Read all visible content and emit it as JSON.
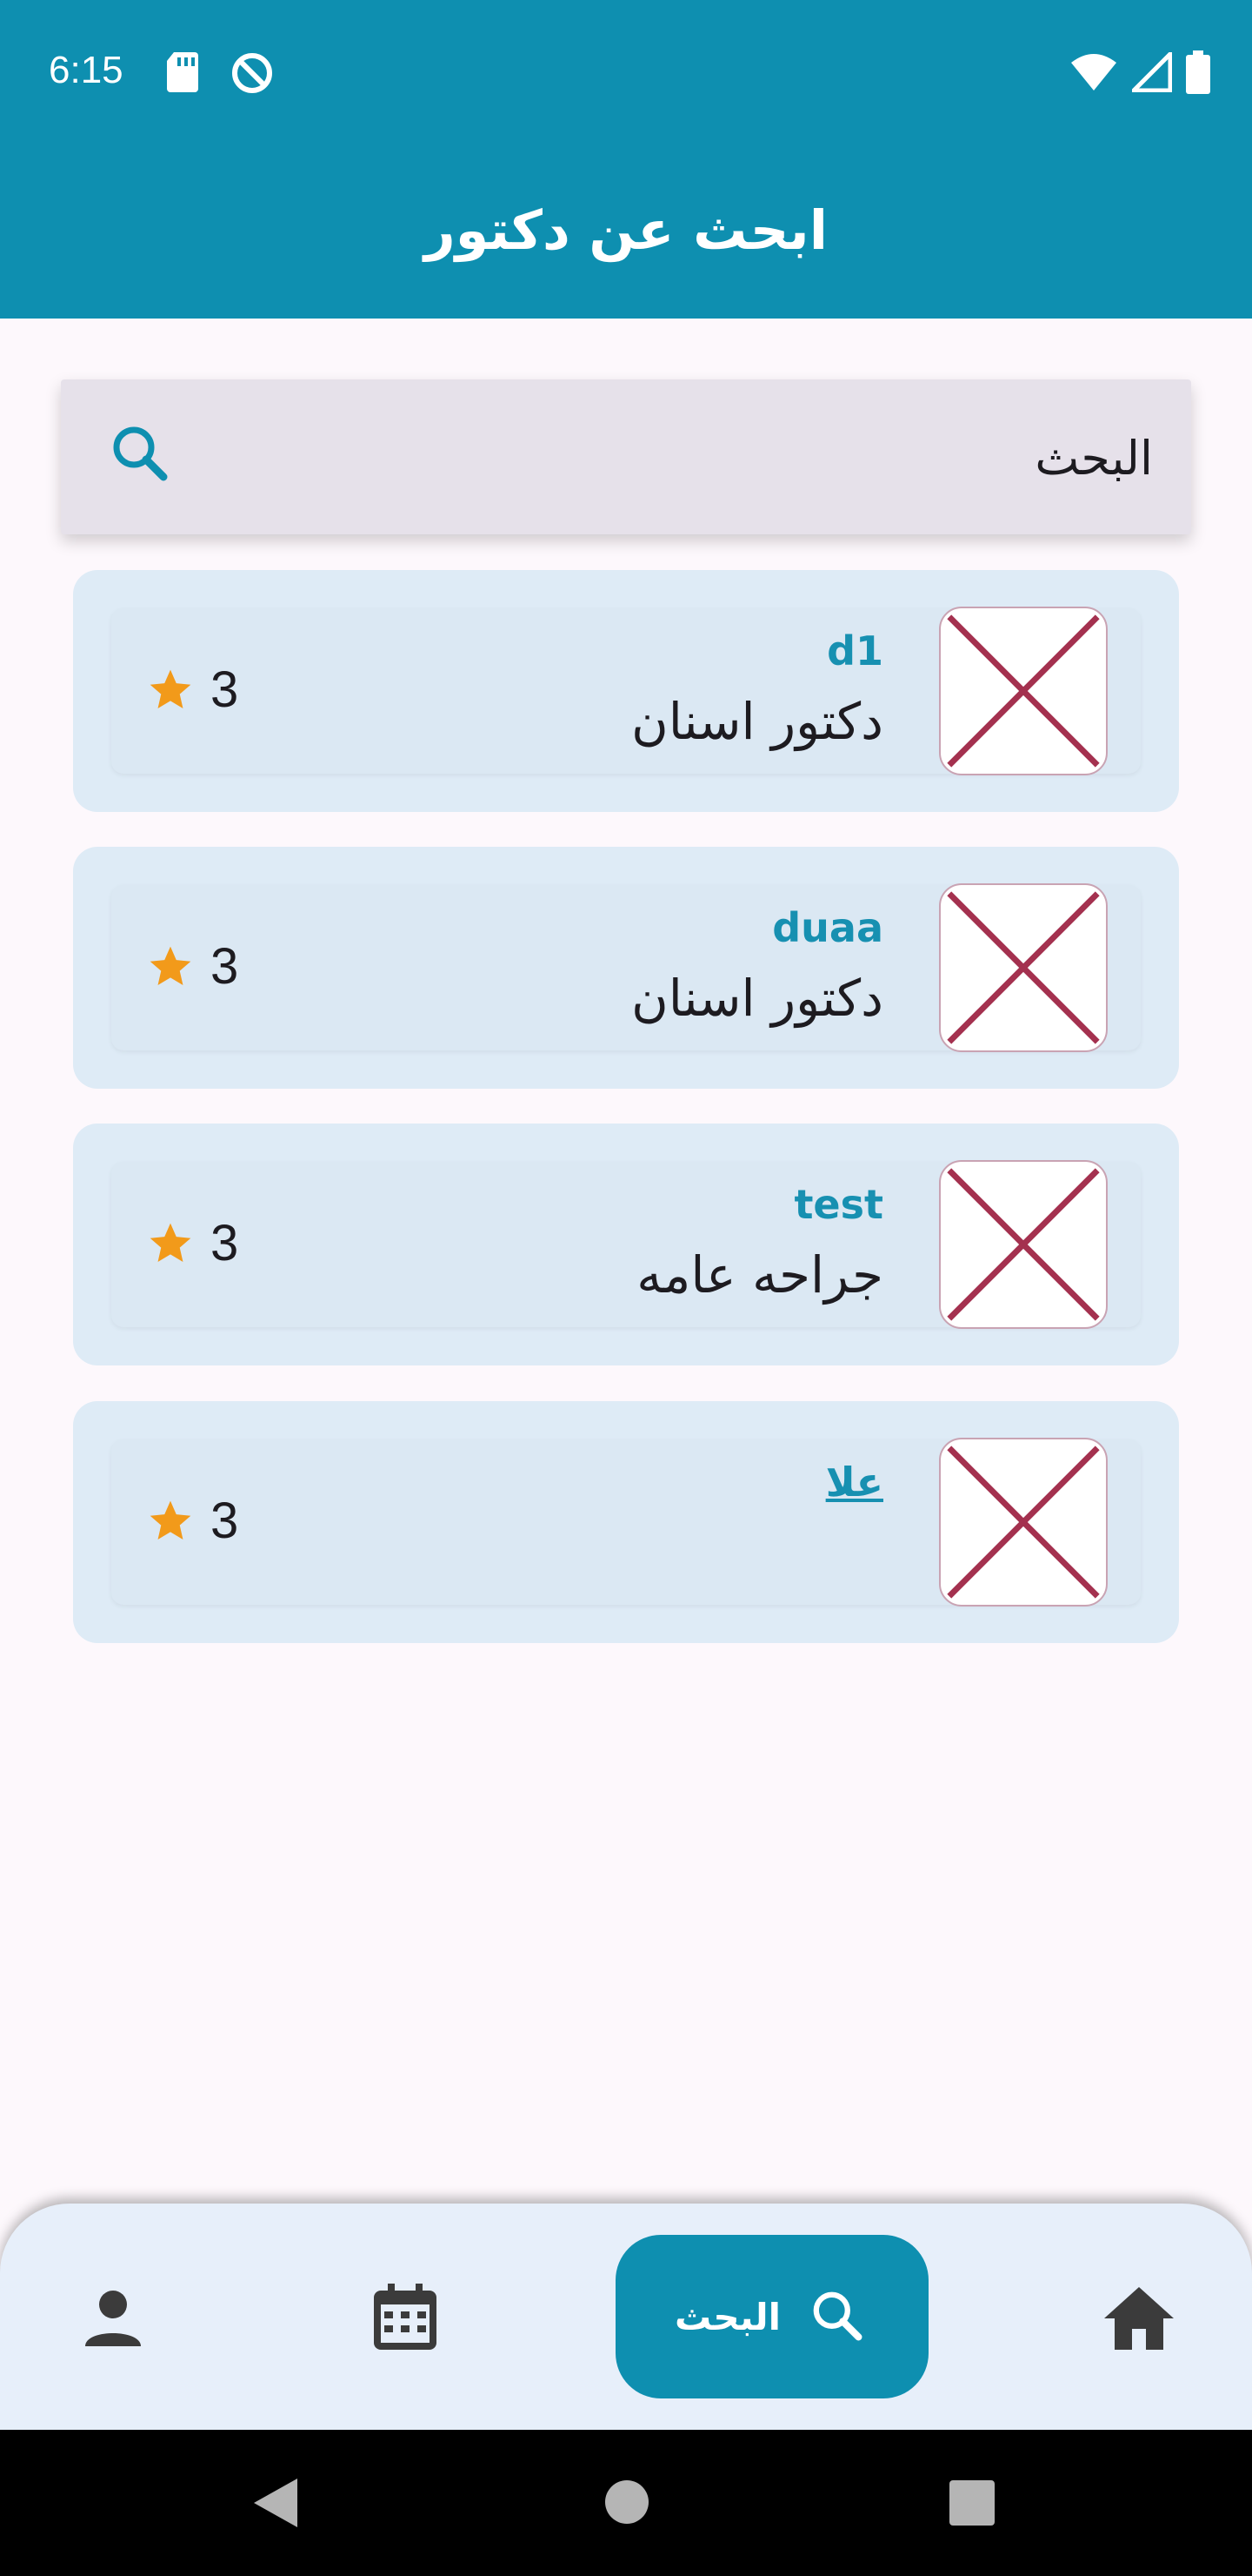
{
  "status_bar": {
    "time": "6:15",
    "left_icons": [
      "sd-card-icon",
      "sync-disabled-icon"
    ],
    "right_icons": [
      "wifi-icon",
      "signal-icon",
      "battery-icon"
    ]
  },
  "app_bar": {
    "title": "ابحث عن دكتور"
  },
  "search": {
    "placeholder": "البحث",
    "value": ""
  },
  "doctors": [
    {
      "name": "d1",
      "specialty": "دكتور اسنان",
      "rating": "3",
      "image": "broken-image"
    },
    {
      "name": "duaa",
      "specialty": "دكتور اسنان",
      "rating": "3",
      "image": "broken-image"
    },
    {
      "name": "test",
      "specialty": "جراحه عامه",
      "rating": "3",
      "image": "broken-image"
    },
    {
      "name": "علا",
      "specialty": "",
      "rating": "3",
      "image": "broken-image"
    }
  ],
  "bottom_nav": {
    "active_label": "البحث",
    "items": [
      "profile-icon",
      "calendar-icon",
      "search-icon",
      "home-icon"
    ]
  },
  "colors": {
    "primary": "#0e8fb0",
    "card": "#deebf6",
    "star": "#f29a1a",
    "name_text": "#1790b1",
    "broken_image_cross": "#a4314f"
  }
}
